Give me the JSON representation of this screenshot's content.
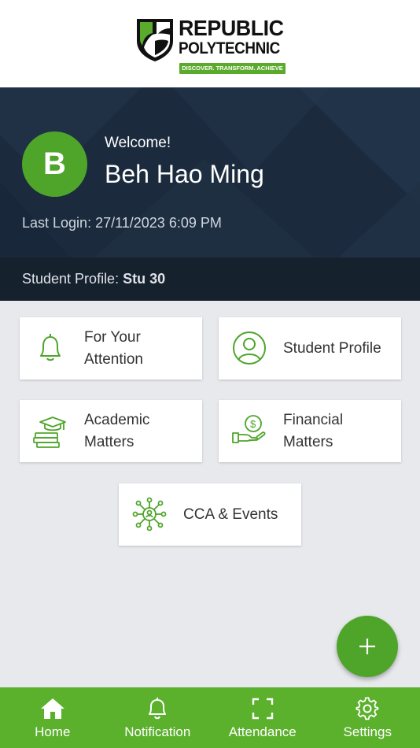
{
  "logo": {
    "line1": "REPUBLIC",
    "line2": "POLYTECHNIC",
    "tagline": "DISCOVER. TRANSFORM. ACHIEVE"
  },
  "user": {
    "avatar_letter": "B",
    "greeting": "Welcome!",
    "name": "Beh Hao Ming",
    "last_login": "Last Login: 27/11/2023 6:09 PM",
    "profile_label": "Student Profile:",
    "profile_value": "Stu 30"
  },
  "tiles": [
    {
      "label": "For Your Attention",
      "icon": "bell-icon"
    },
    {
      "label": "Student Profile",
      "icon": "user-icon"
    },
    {
      "label": "Academic Matters",
      "icon": "books-graduation-icon"
    },
    {
      "label": "Financial Matters",
      "icon": "hand-money-icon"
    },
    {
      "label": "CCA & Events",
      "icon": "network-people-icon"
    }
  ],
  "fab": {
    "icon": "plus-icon"
  },
  "nav": [
    {
      "label": "Home",
      "icon": "home-icon"
    },
    {
      "label": "Notification",
      "icon": "bell-icon"
    },
    {
      "label": "Attendance",
      "icon": "scan-icon"
    },
    {
      "label": "Settings",
      "icon": "gear-icon"
    }
  ],
  "colors": {
    "accent": "#4ea52a",
    "nav_bg": "#5bb02c",
    "hero_bg": "#1a2a3c"
  }
}
